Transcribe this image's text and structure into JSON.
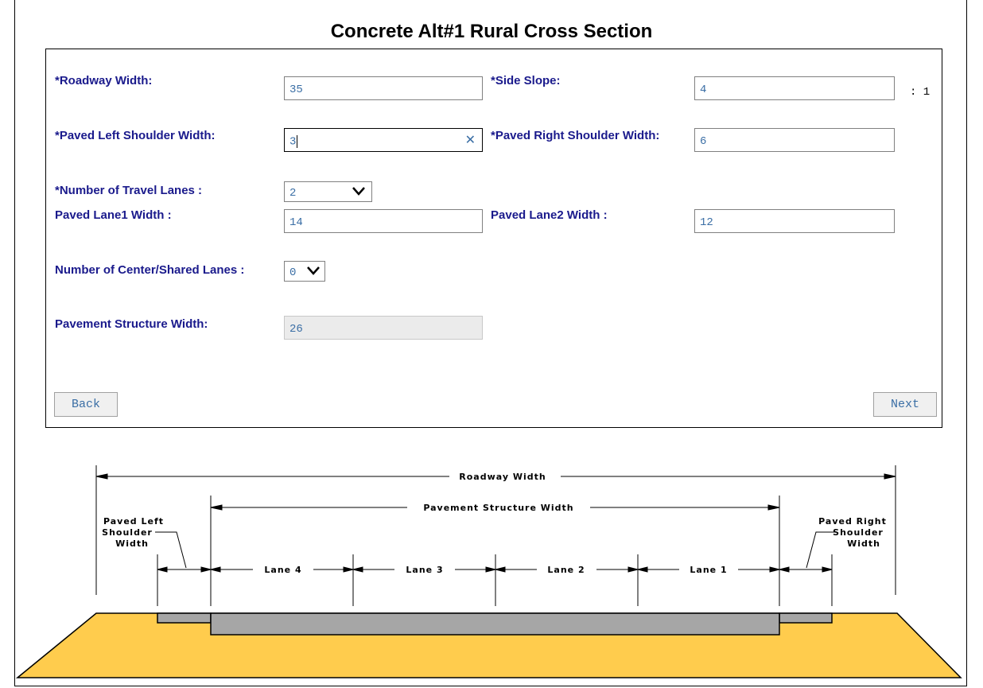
{
  "page": {
    "title": "Concrete Alt#1 Rural Cross Section"
  },
  "form": {
    "roadway_width": {
      "label": "*Roadway Width:",
      "value": "35"
    },
    "side_slope": {
      "label": "*Side Slope:",
      "value": "4",
      "suffix": ": 1"
    },
    "paved_left_shoulder_width": {
      "label": "*Paved Left Shoulder Width:",
      "value": "3",
      "clear_icon": "close-icon"
    },
    "paved_right_shoulder_width": {
      "label": "*Paved Right Shoulder Width:",
      "value": "6"
    },
    "number_of_travel_lanes": {
      "label": "*Number of Travel Lanes :",
      "selected": "2"
    },
    "paved_lane1_width": {
      "label": "Paved Lane1 Width :",
      "value": "14"
    },
    "paved_lane2_width": {
      "label": "Paved Lane2 Width :",
      "value": "12"
    },
    "number_of_center_lanes": {
      "label": "Number of Center/Shared Lanes :",
      "selected": "0"
    },
    "pavement_structure_width": {
      "label": "Pavement Structure Width:",
      "value": "26"
    }
  },
  "buttons": {
    "back": "Back",
    "next": "Next"
  },
  "diagram": {
    "roadway_width": "Roadway Width",
    "pavement_structure_width": "Pavement Structure Width",
    "left_shoulder": [
      "Paved Left",
      "Shoulder",
      "Width"
    ],
    "right_shoulder": [
      "Paved Right",
      "Shoulder",
      "Width"
    ],
    "lanes": [
      "Lane 4",
      "Lane 3",
      "Lane 2",
      "Lane 1"
    ]
  },
  "colors": {
    "label": "#1a1a8c",
    "value": "#3a6ea5",
    "ground": "#ffcc4d",
    "pavement": "#a6a6a6"
  }
}
